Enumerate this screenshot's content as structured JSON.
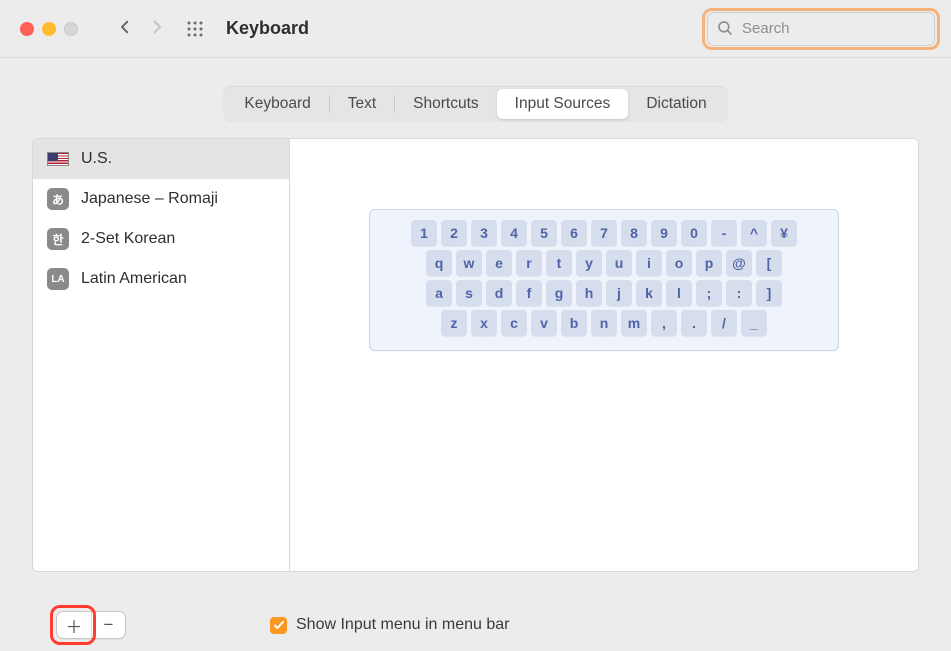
{
  "window": {
    "title": "Keyboard"
  },
  "search": {
    "placeholder": "Search",
    "value": ""
  },
  "tabs": {
    "keyboard": "Keyboard",
    "text": "Text",
    "shortcuts": "Shortcuts",
    "input_sources": "Input Sources",
    "dictation": "Dictation",
    "selected": "input_sources"
  },
  "sources": {
    "items": [
      {
        "label": "U.S.",
        "icon": "flag-us",
        "selected": true
      },
      {
        "label": "Japanese – Romaji",
        "icon": "badge-ja",
        "badge_text": "あ",
        "selected": false
      },
      {
        "label": "2-Set Korean",
        "icon": "badge-ko",
        "badge_text": "한",
        "selected": false
      },
      {
        "label": "Latin American",
        "icon": "badge-la",
        "badge_text": "LA",
        "selected": false
      }
    ]
  },
  "keyboard_preview": {
    "rows": [
      [
        "1",
        "2",
        "3",
        "4",
        "5",
        "6",
        "7",
        "8",
        "9",
        "0",
        "-",
        "^",
        "¥"
      ],
      [
        "q",
        "w",
        "e",
        "r",
        "t",
        "y",
        "u",
        "i",
        "o",
        "p",
        "@",
        "["
      ],
      [
        "a",
        "s",
        "d",
        "f",
        "g",
        "h",
        "j",
        "k",
        "l",
        ";",
        ":",
        "]"
      ],
      [
        "z",
        "x",
        "c",
        "v",
        "b",
        "n",
        "m",
        ",",
        ".",
        "/",
        "_"
      ]
    ]
  },
  "footer": {
    "checkbox_label": "Show Input menu in menu bar",
    "checkbox_checked": true
  }
}
